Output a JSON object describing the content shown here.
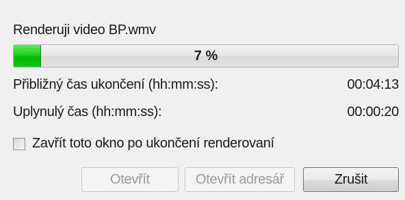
{
  "dialog": {
    "status_text": "Renderuji video BP.wmv",
    "progress": {
      "percent": 7,
      "label": "7 %",
      "fill_color": "#1cd41c"
    },
    "eta": {
      "label": "Přibližný čas ukončení (hh:mm:ss):",
      "value": "00:04:13"
    },
    "elapsed": {
      "label": "Uplynulý čas (hh:mm:ss):",
      "value": "00:00:20"
    },
    "close_after_render": {
      "label": "Zavřít toto okno po ukončení renderovaní",
      "checked": false
    },
    "buttons": {
      "open_label": "Otevřít",
      "open_folder_label": "Otevřít adresář",
      "cancel_label": "Zrušit"
    }
  }
}
